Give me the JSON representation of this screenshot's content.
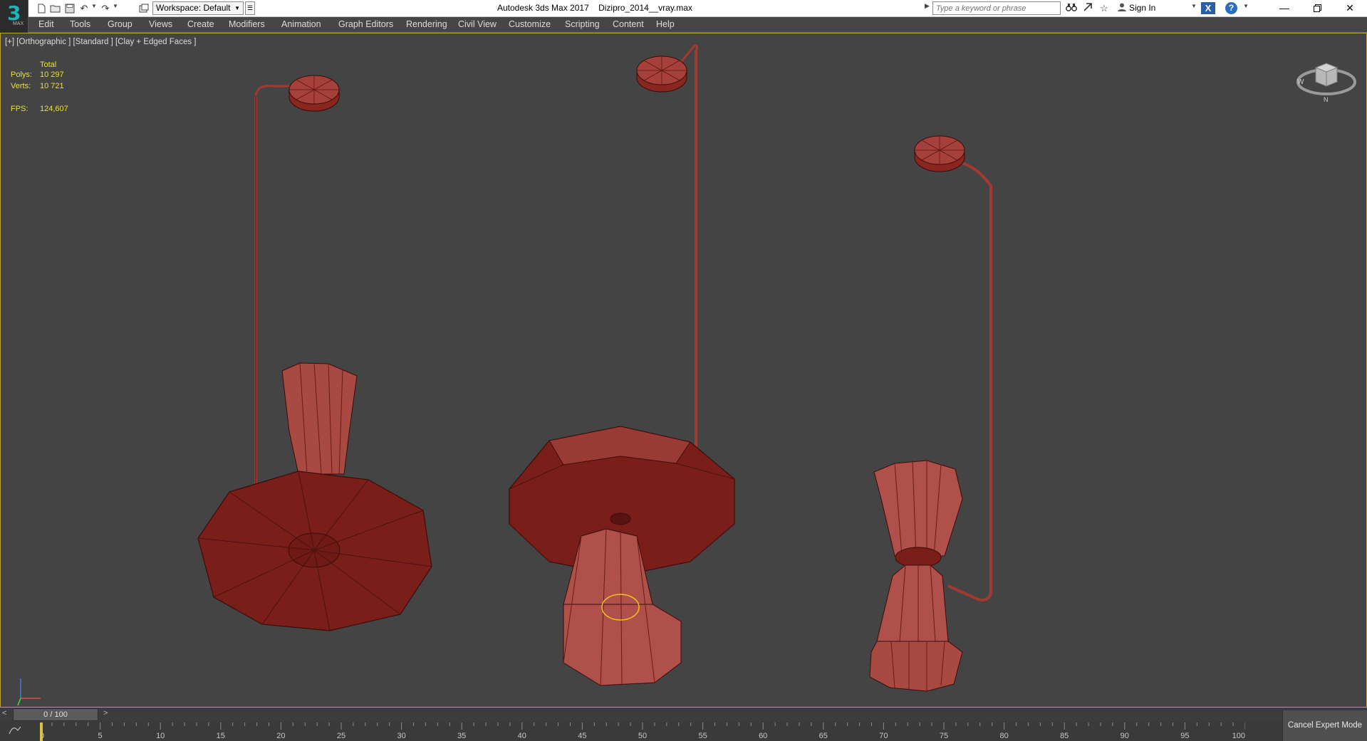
{
  "titlebar": {
    "app_name": "Autodesk 3ds Max 2017",
    "file_name": "Dizipro_2014__vray.max",
    "workspace_label": "Workspace: Default",
    "search_placeholder": "Type a keyword or phrase",
    "sign_in": "Sign In",
    "logo_number": "3",
    "logo_sub": "MAX"
  },
  "menu": [
    "Edit",
    "Tools",
    "Group",
    "Views",
    "Create",
    "Modifiers",
    "Animation",
    "Graph Editors",
    "Rendering",
    "Civil View",
    "Customize",
    "Scripting",
    "Content",
    "Help"
  ],
  "viewport": {
    "label": "[+] [Orthographic ] [Standard ] [Clay + Edged Faces ]",
    "stats": {
      "header": "Total",
      "polys_label": "Polys:",
      "polys_value": "10 297",
      "verts_label": "Verts:",
      "verts_value": "10 721",
      "fps_label": "FPS:",
      "fps_value": "124,607"
    },
    "viewcube_letters": [
      "W",
      "N"
    ],
    "colors": {
      "accent_border": "#bfa238",
      "object": "#8e2a24",
      "stats_text": "#e8e040"
    }
  },
  "timeline": {
    "frame_display": "0 / 100",
    "prev": "<",
    "next": ">",
    "ticks": [
      "0",
      "5",
      "10",
      "15",
      "20",
      "25",
      "30",
      "35",
      "40",
      "45",
      "50",
      "55",
      "60",
      "65",
      "70",
      "75",
      "80",
      "85",
      "90",
      "95",
      "100"
    ],
    "curve_icon": "curve-editor-icon",
    "cancel_expert_mode": "Cancel Expert Mode"
  }
}
